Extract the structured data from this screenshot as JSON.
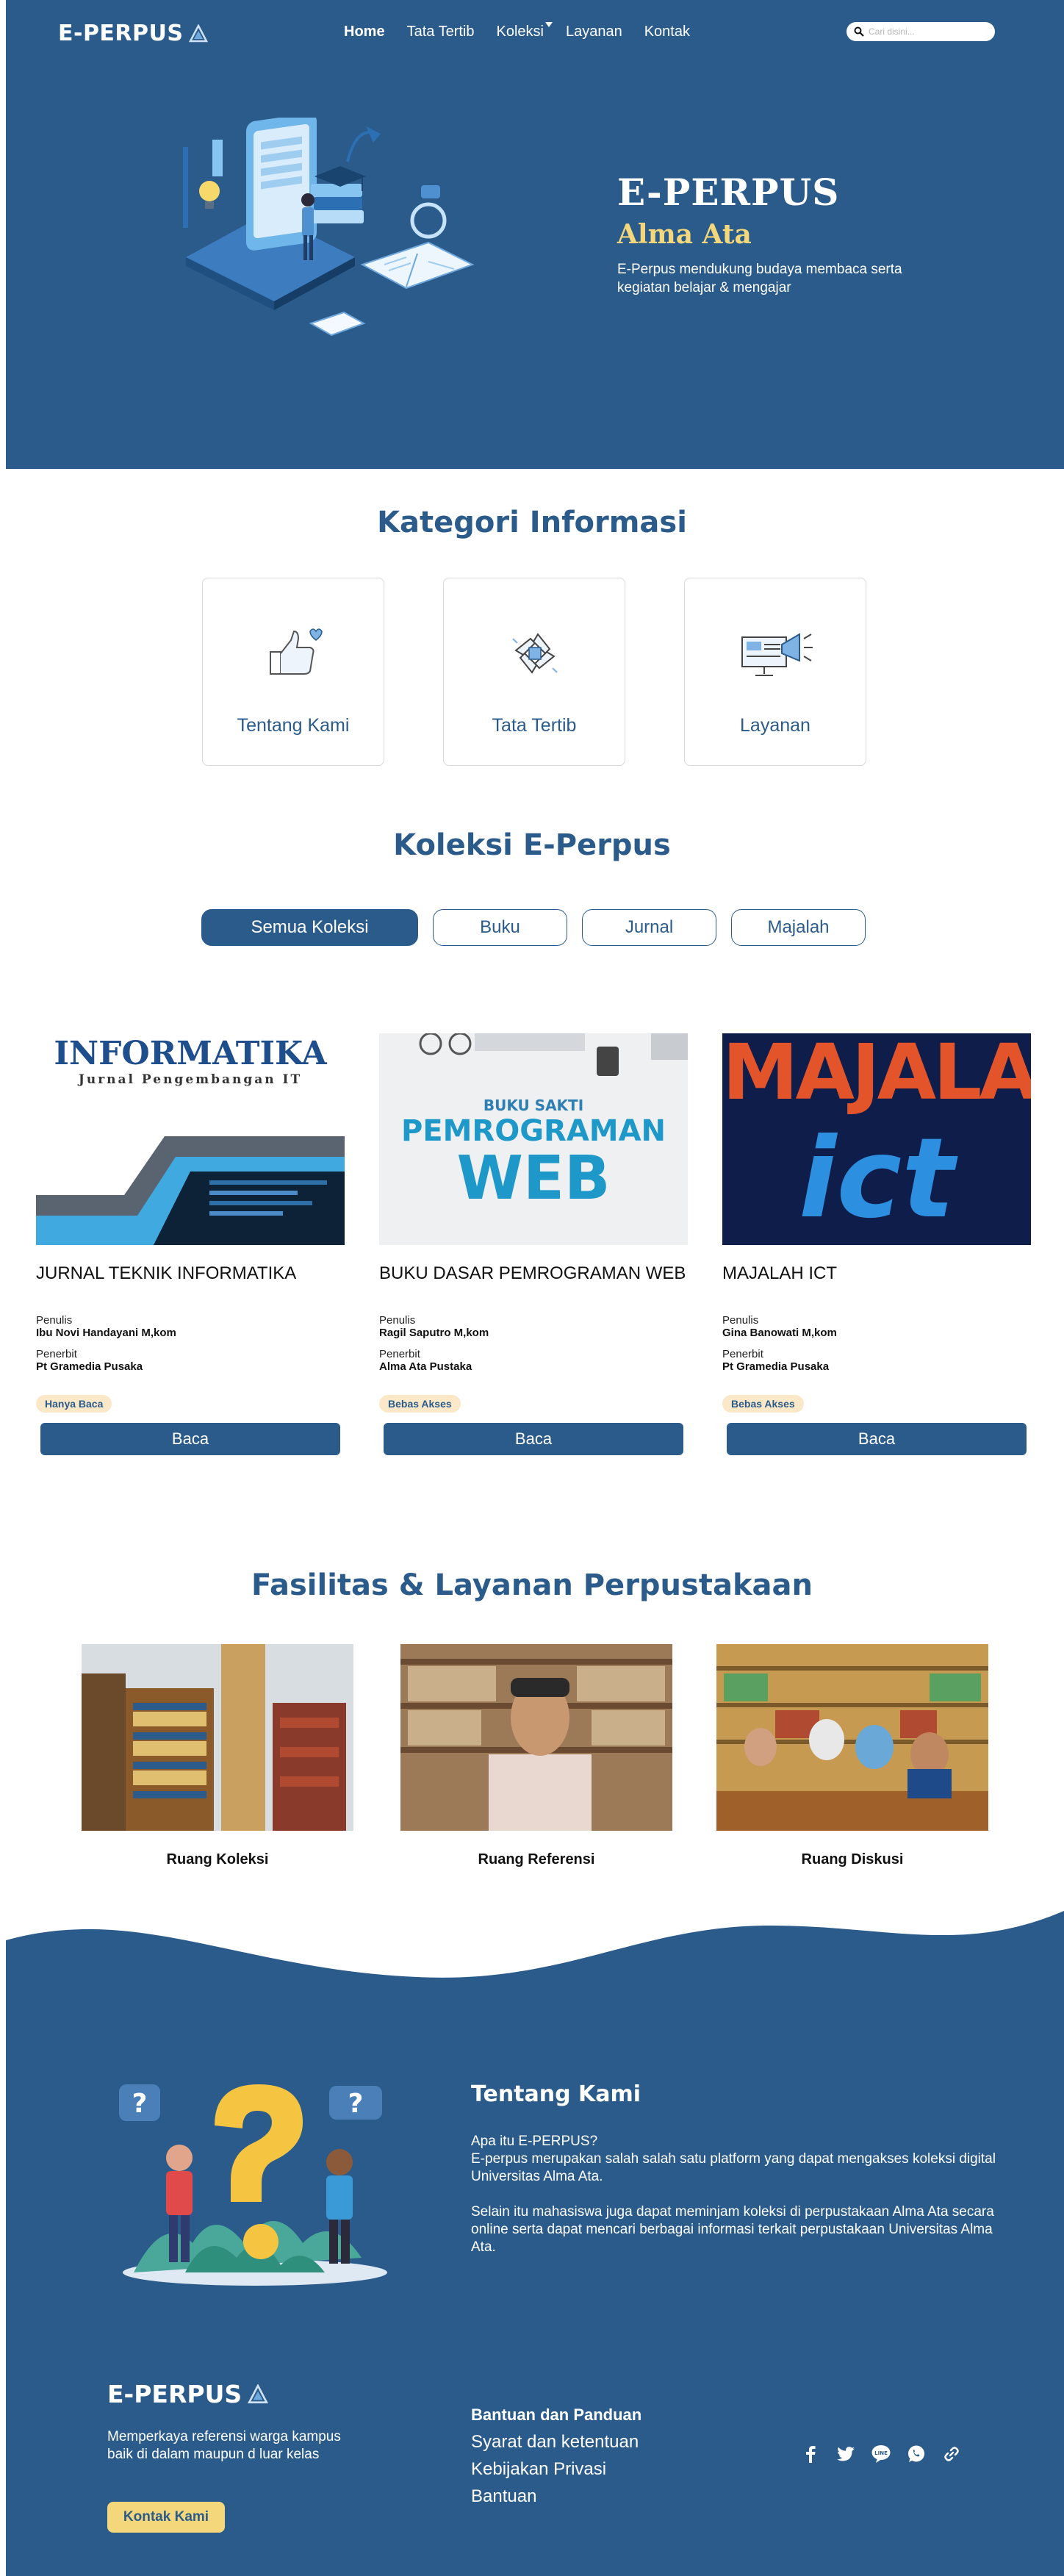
{
  "nav": {
    "brand": "E-PERPUS",
    "links": [
      "Home",
      "Tata Tertib",
      "Koleksi",
      "Layanan",
      "Kontak"
    ],
    "search_placeholder": "Cari disini..."
  },
  "hero": {
    "title": "E-PERPUS",
    "subtitle": "Alma Ata",
    "description": "E-Perpus mendukung budaya membaca serta kegiatan belajar & mengajar"
  },
  "kategori": {
    "title": "Kategori Informasi",
    "cards": [
      {
        "label": "Tentang Kami",
        "icon": "thumbs-up-heart-icon"
      },
      {
        "label": "Tata Tertib",
        "icon": "hands-together-icon"
      },
      {
        "label": "Layanan",
        "icon": "megaphone-screen-icon"
      }
    ]
  },
  "koleksi": {
    "title": "Koleksi E-Perpus",
    "filters": [
      "Semua Koleksi",
      "Buku",
      "Jurnal",
      "Majalah"
    ],
    "active_filter": "Semua Koleksi",
    "books": [
      {
        "title": "JURNAL TEKNIK INFORMATIKA",
        "cover_title": "INFORMATIKA",
        "cover_subtitle": "Jurnal Pengembangan IT",
        "penulis_label": "Penulis",
        "penulis": "Ibu Novi Handayani M,kom",
        "penerbit_label": "Penerbit",
        "penerbit": "Pt Gramedia Pusaka",
        "badge": "Hanya Baca",
        "button": "Baca"
      },
      {
        "title": "BUKU DASAR PEMROGRAMAN WEB",
        "cover_title": "BUKU SAKTI",
        "cover_subtitle": "PEMROGRAMAN",
        "cover_word": "WEB",
        "penulis_label": "Penulis",
        "penulis": "Ragil Saputro M,kom",
        "penerbit_label": "Penerbit",
        "penerbit": "Alma Ata Pustaka",
        "badge": "Bebas Akses",
        "button": "Baca"
      },
      {
        "title": "MAJALAH ICT",
        "cover_title": "MAJALAH",
        "cover_subtitle": "ict",
        "penulis_label": "Penulis",
        "penulis": "Gina Banowati M,kom",
        "penerbit_label": "Penerbit",
        "penerbit": "Pt Gramedia Pusaka",
        "badge": "Bebas Akses",
        "button": "Baca"
      }
    ]
  },
  "fasilitas": {
    "title": "Fasilitas & Layanan Perpustakaan",
    "items": [
      "Ruang Koleksi",
      "Ruang Referensi",
      "Ruang Diskusi"
    ]
  },
  "about": {
    "title": "Tentang Kami",
    "paragraph1_line1": "Apa itu E-PERPUS?",
    "paragraph1_line2": "E-perpus merupakan salah salah satu platform yang dapat mengakses koleksi digital Universitas Alma Ata.",
    "paragraph2": "Selain itu mahasiswa juga dapat meminjam koleksi di perpustakaan Alma Ata secara online serta dapat mencari berbagai informasi terkait perpustakaan Universitas Alma Ata."
  },
  "footer": {
    "brand": "E-PERPUS",
    "tagline": "Memperkaya referensi warga kampus baik di dalam maupun d luar kelas",
    "contact_button": "Kontak Kami",
    "help_title": "Bantuan dan Panduan",
    "help_links": [
      "Syarat dan ketentuan",
      "Kebijakan Privasi",
      "Bantuan"
    ],
    "socials": [
      "facebook-icon",
      "twitter-icon",
      "line-icon",
      "whatsapp-icon",
      "link-icon"
    ]
  },
  "colors": {
    "primary": "#2a5b8b",
    "accent_yellow": "#f4d77a",
    "badge_bg": "#fbe8c8"
  }
}
